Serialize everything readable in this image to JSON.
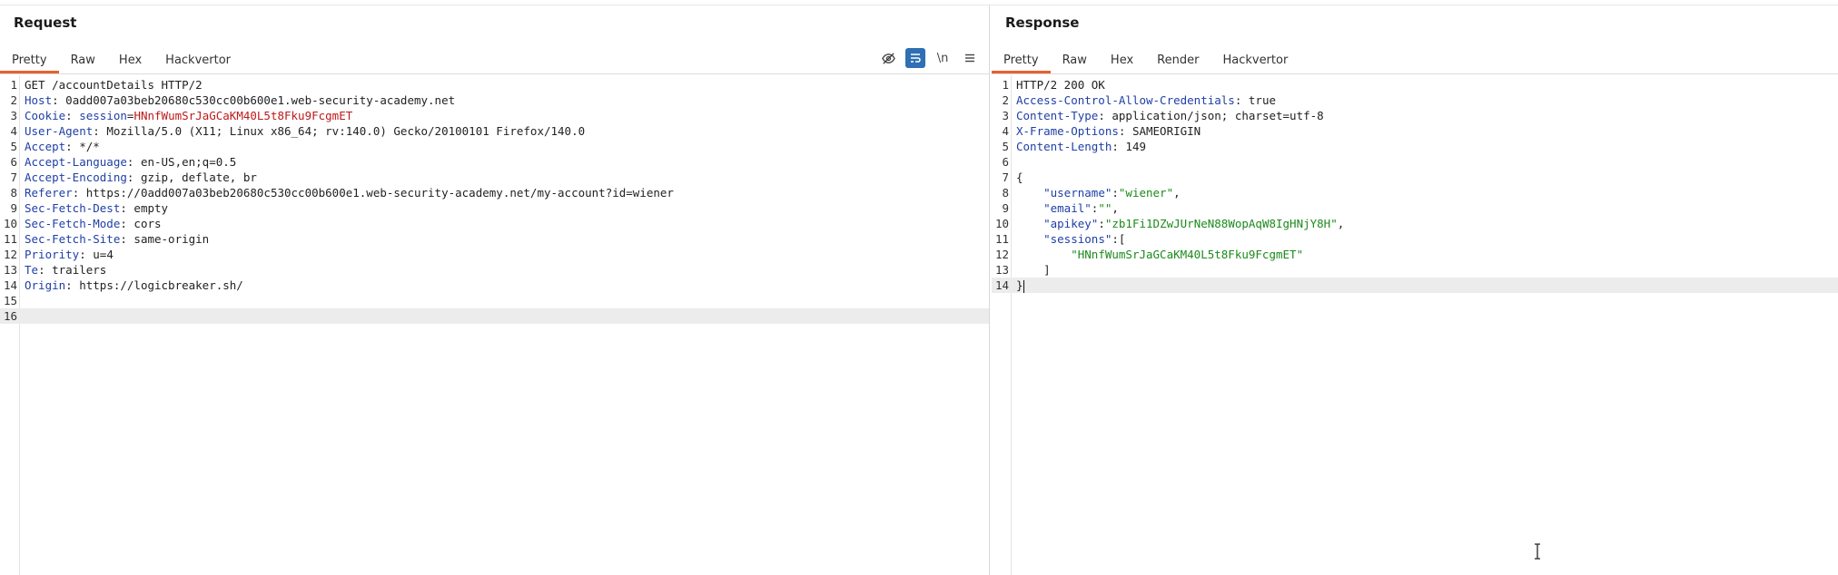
{
  "request": {
    "title": "Request",
    "tabs": [
      {
        "label": "Pretty",
        "active": true
      },
      {
        "label": "Raw"
      },
      {
        "label": "Hex"
      },
      {
        "label": "Hackvertor"
      }
    ],
    "toolbar": [
      {
        "icon": "eye-slash-icon"
      },
      {
        "icon": "wrap-lines-icon",
        "active": true
      },
      {
        "icon": "newline-icon",
        "text": "\\n"
      },
      {
        "icon": "menu-icon"
      }
    ],
    "lines": [
      {
        "n": "1",
        "text": "GET /accountDetails HTTP/2"
      },
      {
        "n": "2",
        "name": "Host",
        "value": "0add007a03beb20680c530cc00b600e1.web-security-academy.net"
      },
      {
        "n": "3",
        "name": "Cookie",
        "cookie_name": "session",
        "cookie_value": "HNnfWumSrJaGCaKM40L5t8Fku9FcgmET"
      },
      {
        "n": "4",
        "name": "User-Agent",
        "value": "Mozilla/5.0 (X11; Linux x86_64; rv:140.0) Gecko/20100101 Firefox/140.0"
      },
      {
        "n": "5",
        "name": "Accept",
        "value": "*/*"
      },
      {
        "n": "6",
        "name": "Accept-Language",
        "value": "en-US,en;q=0.5"
      },
      {
        "n": "7",
        "name": "Accept-Encoding",
        "value": "gzip, deflate, br"
      },
      {
        "n": "8",
        "name": "Referer",
        "value": "https://0add007a03beb20680c530cc00b600e1.web-security-academy.net/my-account?id=wiener"
      },
      {
        "n": "9",
        "name": "Sec-Fetch-Dest",
        "value": "empty"
      },
      {
        "n": "10",
        "name": "Sec-Fetch-Mode",
        "value": "cors"
      },
      {
        "n": "11",
        "name": "Sec-Fetch-Site",
        "value": "same-origin"
      },
      {
        "n": "12",
        "name": "Priority",
        "value": "u=4"
      },
      {
        "n": "13",
        "name": "Te",
        "value": "trailers"
      },
      {
        "n": "14",
        "name": "Origin",
        "value": "https://logicbreaker.sh/"
      },
      {
        "n": "15"
      },
      {
        "n": "16",
        "current": true
      }
    ]
  },
  "response": {
    "title": "Response",
    "tabs": [
      {
        "label": "Pretty",
        "active": true
      },
      {
        "label": "Raw"
      },
      {
        "label": "Hex"
      },
      {
        "label": "Render"
      },
      {
        "label": "Hackvertor"
      }
    ],
    "lines": [
      {
        "n": "1",
        "text": "HTTP/2 200 OK"
      },
      {
        "n": "2",
        "name": "Access-Control-Allow-Credentials",
        "value": "true"
      },
      {
        "n": "3",
        "name": "Content-Type",
        "value": "application/json; charset=utf-8"
      },
      {
        "n": "4",
        "name": "X-Frame-Options",
        "value": "SAMEORIGIN"
      },
      {
        "n": "5",
        "name": "Content-Length",
        "value": "149"
      },
      {
        "n": "6"
      },
      {
        "n": "7",
        "text": "{"
      },
      {
        "n": "8",
        "json_key": "\"username\"",
        "json_value": "\"wiener\"",
        "trail": ",",
        "indent": 1
      },
      {
        "n": "9",
        "json_key": "\"email\"",
        "json_value": "\"\"",
        "trail": ",",
        "indent": 1
      },
      {
        "n": "10",
        "json_key": "\"apikey\"",
        "json_value": "\"zb1Fi1DZwJUrNeN88WopAqW8IgHNjY8H\"",
        "trail": ",",
        "indent": 1
      },
      {
        "n": "11",
        "json_key": "\"sessions\"",
        "json_value": "[",
        "indent": 1,
        "bracket": true
      },
      {
        "n": "12",
        "json_str": "\"HNnfWumSrJaGCaKM40L5t8Fku9FcgmET\"",
        "indent": 2
      },
      {
        "n": "13",
        "text": "]",
        "indent": 1
      },
      {
        "n": "14",
        "text": "}",
        "current": true
      }
    ]
  },
  "colors": {
    "accent": "#e8602c",
    "header_name": "#1f3fa6",
    "cookie_value": "#c01818",
    "json_string": "#1c8a1c",
    "toggle_on": "#2f6fb3"
  }
}
